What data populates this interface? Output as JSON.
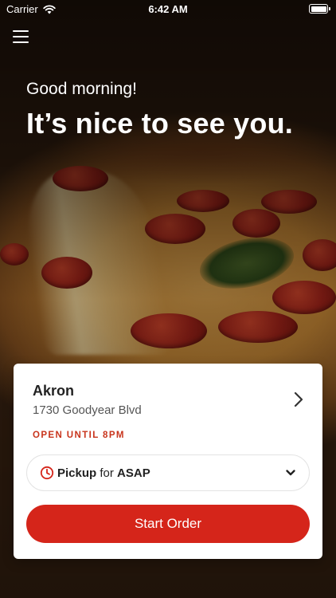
{
  "status_bar": {
    "carrier": "Carrier",
    "time": "6:42 AM",
    "wifi_icon": "wifi-icon",
    "battery_icon": "battery-icon"
  },
  "header": {
    "menu_icon": "hamburger-menu-icon",
    "greeting": "Good morning!",
    "headline": "It’s nice to see you."
  },
  "store": {
    "name": "Akron",
    "address": "1730 Goodyear Blvd",
    "open_status": "OPEN UNTIL 8PM",
    "chevron_icon": "chevron-right-icon"
  },
  "order_mode": {
    "method": "Pickup",
    "connector": "for",
    "time": "ASAP",
    "clock_icon": "clock-icon",
    "dropdown_icon": "chevron-down-icon"
  },
  "actions": {
    "start_order_label": "Start Order"
  },
  "colors": {
    "accent": "#d5251a",
    "open_status": "#c8341c",
    "card_bg": "#ffffff"
  }
}
